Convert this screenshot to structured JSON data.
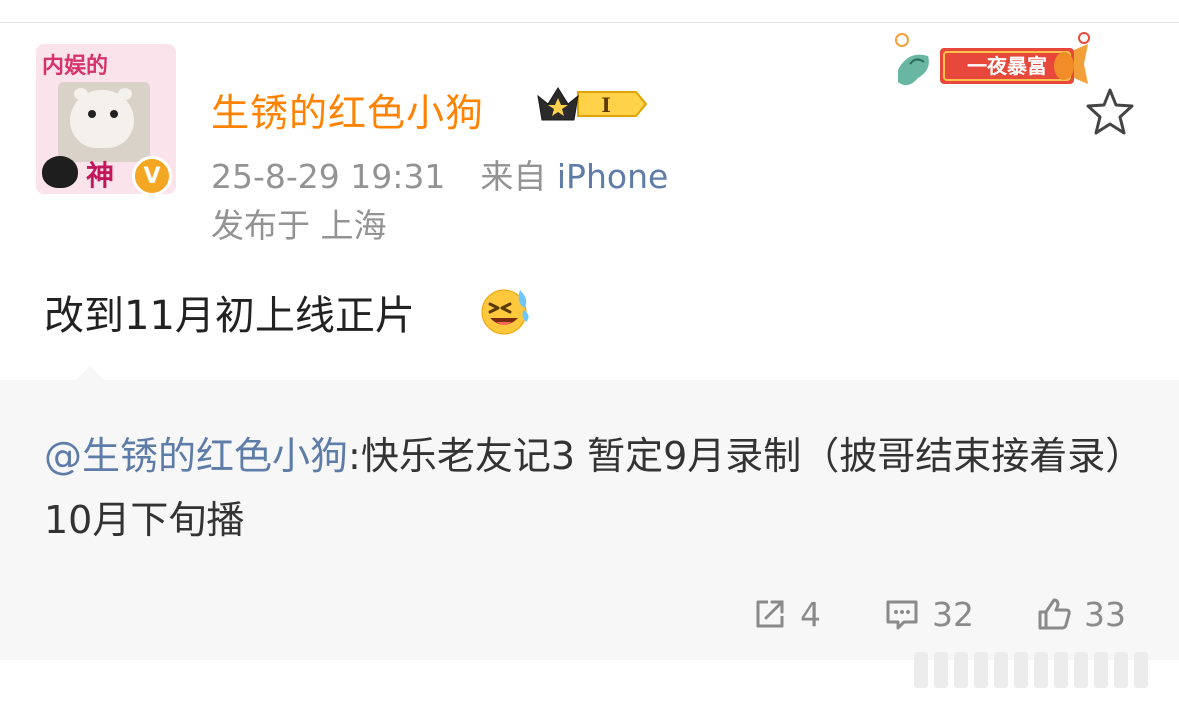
{
  "post": {
    "username": "生锈的红色小狗",
    "level_badge": "I",
    "timestamp": "25-8-29 19:31",
    "source_prefix": "来自",
    "device": "iPhone",
    "location": "发布于 上海",
    "text": "改到11月初上线正片",
    "avatar_top_text": "内娱的",
    "avatar_bottom_text": "神",
    "verified_badge": "V",
    "banner_text": "一夜暴富"
  },
  "repost": {
    "mention": "@生锈的红色小狗",
    "text": ":快乐老友记3  暂定9月录制（披哥结束接着录）10月下旬播"
  },
  "actions": {
    "share_count": "4",
    "comment_count": "32",
    "like_count": "33"
  },
  "icons": [
    "star-icon",
    "share-icon",
    "comment-icon",
    "like-icon",
    "laugh-cry-emoji",
    "crown-badge-icon",
    "verified-badge-icon"
  ],
  "colors": {
    "username": "#ff8200",
    "link": "#5d7ca8",
    "meta": "#939393",
    "repost_bg": "#f7f7f7"
  }
}
